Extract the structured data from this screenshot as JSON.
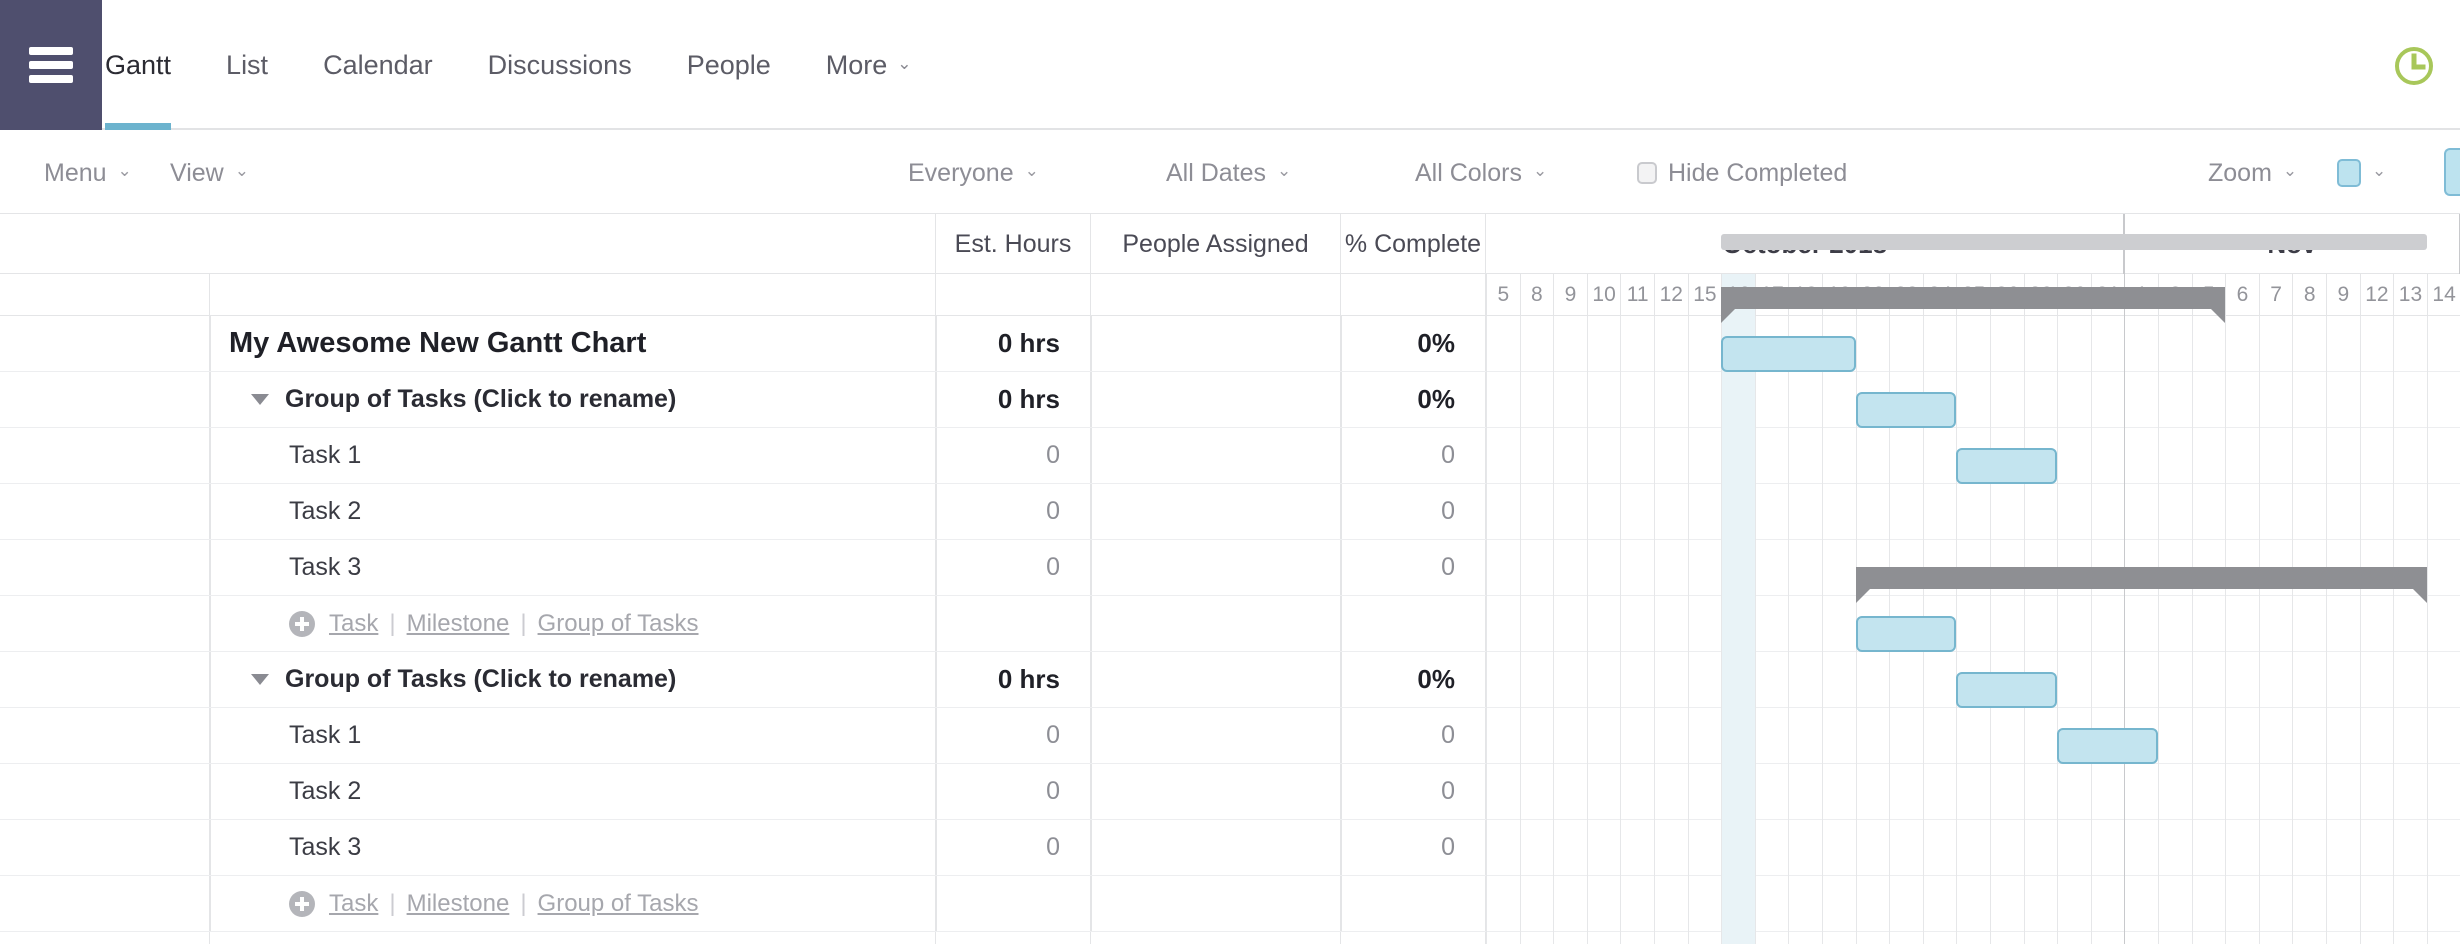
{
  "topbar": {
    "menu_icon": "hamburger-icon",
    "clock_icon": "clock-icon",
    "tabs": [
      {
        "label": "Gantt",
        "active": true,
        "caret": ""
      },
      {
        "label": "List",
        "active": false,
        "caret": ""
      },
      {
        "label": "Calendar",
        "active": false,
        "caret": ""
      },
      {
        "label": "Discussions",
        "active": false,
        "caret": ""
      },
      {
        "label": "People",
        "active": false,
        "caret": ""
      },
      {
        "label": "More",
        "active": false,
        "caret": "⌄"
      }
    ]
  },
  "toolbar": {
    "menu_label": "Menu",
    "view_label": "View",
    "everyone_label": "Everyone",
    "all_dates_label": "All Dates",
    "all_colors_label": "All Colors",
    "hide_completed_label": "Hide Completed",
    "hide_completed_checked": false,
    "zoom_label": "Zoom",
    "caret": "⌄",
    "swatch_color": "#bde3ef"
  },
  "columns": {
    "est_hours": "Est. Hours",
    "people_assigned": "People Assigned",
    "percent_complete": "% Complete"
  },
  "timeline": {
    "months": [
      {
        "label": "October 2018",
        "start_index": 0,
        "span": 19
      },
      {
        "label": "Nov",
        "start_index": 19,
        "span": 10
      }
    ],
    "days": [
      "5",
      "8",
      "9",
      "10",
      "11",
      "12",
      "15",
      "16",
      "17",
      "18",
      "19",
      "22",
      "23",
      "24",
      "25",
      "26",
      "29",
      "30",
      "31",
      "1",
      "2",
      "5",
      "6",
      "7",
      "8",
      "9",
      "12",
      "13",
      "14"
    ],
    "today_index": 7,
    "col_width": 33.6
  },
  "rows": [
    {
      "type": "project",
      "name": "My Awesome New Gantt Chart",
      "est_hours": "0 hrs",
      "people": "",
      "percent": "0%",
      "bar": {
        "kind": "project",
        "start": 7,
        "end": 28
      }
    },
    {
      "type": "group",
      "name": "Group of Tasks (Click to rename)",
      "est_hours": "0 hrs",
      "people": "",
      "percent": "0%",
      "bar": {
        "kind": "summary",
        "start": 7,
        "end": 22
      }
    },
    {
      "type": "task",
      "name": "Task 1",
      "est_hours": "0",
      "people": "",
      "percent": "0",
      "bar": {
        "kind": "task",
        "start": 7,
        "end": 11
      }
    },
    {
      "type": "task",
      "name": "Task 2",
      "est_hours": "0",
      "people": "",
      "percent": "0",
      "bar": {
        "kind": "task",
        "start": 11,
        "end": 14
      }
    },
    {
      "type": "task",
      "name": "Task 3",
      "est_hours": "0",
      "people": "",
      "percent": "0",
      "bar": {
        "kind": "task",
        "start": 14,
        "end": 17
      }
    },
    {
      "type": "add",
      "name": "",
      "est_hours": "",
      "people": "",
      "percent": "",
      "bar": null
    },
    {
      "type": "group",
      "name": "Group of Tasks (Click to rename)",
      "est_hours": "0 hrs",
      "people": "",
      "percent": "0%",
      "bar": {
        "kind": "summary",
        "start": 11,
        "end": 28
      }
    },
    {
      "type": "task",
      "name": "Task 1",
      "est_hours": "0",
      "people": "",
      "percent": "0",
      "bar": {
        "kind": "task",
        "start": 11,
        "end": 14
      }
    },
    {
      "type": "task",
      "name": "Task 2",
      "est_hours": "0",
      "people": "",
      "percent": "0",
      "bar": {
        "kind": "task",
        "start": 14,
        "end": 17
      }
    },
    {
      "type": "task",
      "name": "Task 3",
      "est_hours": "0",
      "people": "",
      "percent": "0",
      "bar": {
        "kind": "task",
        "start": 17,
        "end": 20
      }
    },
    {
      "type": "add",
      "name": "",
      "est_hours": "",
      "people": "",
      "percent": "",
      "bar": null
    }
  ],
  "add_row": {
    "task_label": "Task",
    "milestone_label": "Milestone",
    "group_label": "Group of Tasks",
    "separator": "|"
  },
  "colors": {
    "sidebar": "#4f4f6e",
    "tab_accent": "#6cb3ce",
    "task_bar_fill": "#c3e4ef",
    "task_bar_border": "#76b6ce",
    "summary_bar": "#8e8f93",
    "project_bar": "#cdced1",
    "today_highlight": "#e9f3f7",
    "clock_icon": "#a8c75a"
  }
}
